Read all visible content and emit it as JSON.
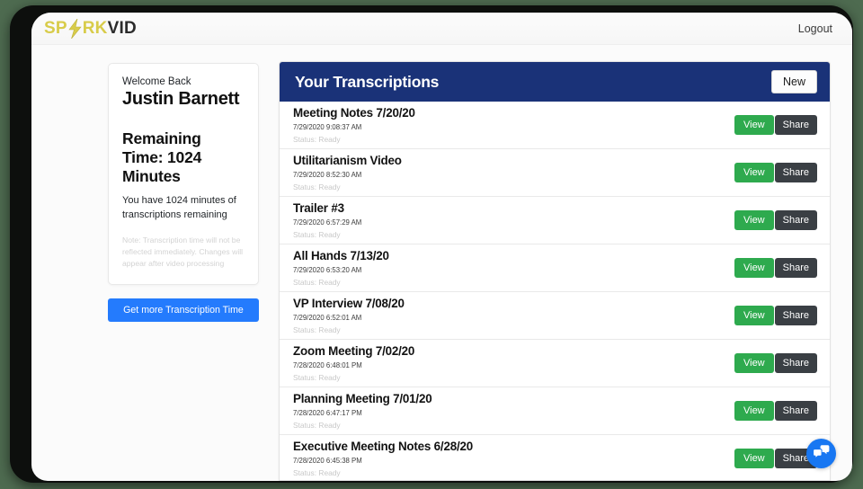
{
  "navbar": {
    "brand_part1": "SP",
    "brand_bolt_icon": "lightning-bolt-icon",
    "brand_part2": "RK",
    "brand_part3": "VID",
    "logout_label": "Logout"
  },
  "sidebar": {
    "welcome_eyebrow": "Welcome Back",
    "user_name": "Justin Barnett",
    "remaining_heading": "Remaining Time: 1024 Minutes",
    "remaining_sub": "You have 1024 minutes of transcriptions remaining",
    "remaining_note": "Note: Transcription time will not be reflected immediately. Changes will appear after video processing",
    "get_more_label": "Get more Transcription Time"
  },
  "main": {
    "panel_title": "Your Transcriptions",
    "new_button_label": "New",
    "view_label": "View",
    "share_label": "Share",
    "transcriptions": [
      {
        "title": "Meeting Notes 7/20/20",
        "timestamp": "7/29/2020 9:08:37 AM",
        "status": "Status: Ready"
      },
      {
        "title": "Utilitarianism Video",
        "timestamp": "7/29/2020 8:52:30 AM",
        "status": "Status: Ready"
      },
      {
        "title": "Trailer #3",
        "timestamp": "7/29/2020 6:57:29 AM",
        "status": "Status: Ready"
      },
      {
        "title": "All Hands 7/13/20",
        "timestamp": "7/29/2020 6:53:20 AM",
        "status": "Status: Ready"
      },
      {
        "title": "VP Interview 7/08/20",
        "timestamp": "7/29/2020 6:52:01 AM",
        "status": "Status: Ready"
      },
      {
        "title": "Zoom Meeting 7/02/20",
        "timestamp": "7/28/2020 6:48:01 PM",
        "status": "Status: Ready"
      },
      {
        "title": "Planning Meeting 7/01/20",
        "timestamp": "7/28/2020 6:47:17 PM",
        "status": "Status: Ready"
      },
      {
        "title": "Executive Meeting Notes 6/28/20",
        "timestamp": "7/28/2020 6:45:38 PM",
        "status": "Status: Ready"
      }
    ]
  },
  "chat": {
    "icon": "chat-bubbles-icon"
  },
  "colors": {
    "brand_gold": "#d8cc4a",
    "panel_header_navy": "#1a3278",
    "view_green": "#2eaa4e",
    "share_dark": "#3a3f44",
    "cta_blue": "#247bfd",
    "chat_blue": "#1877f2"
  }
}
